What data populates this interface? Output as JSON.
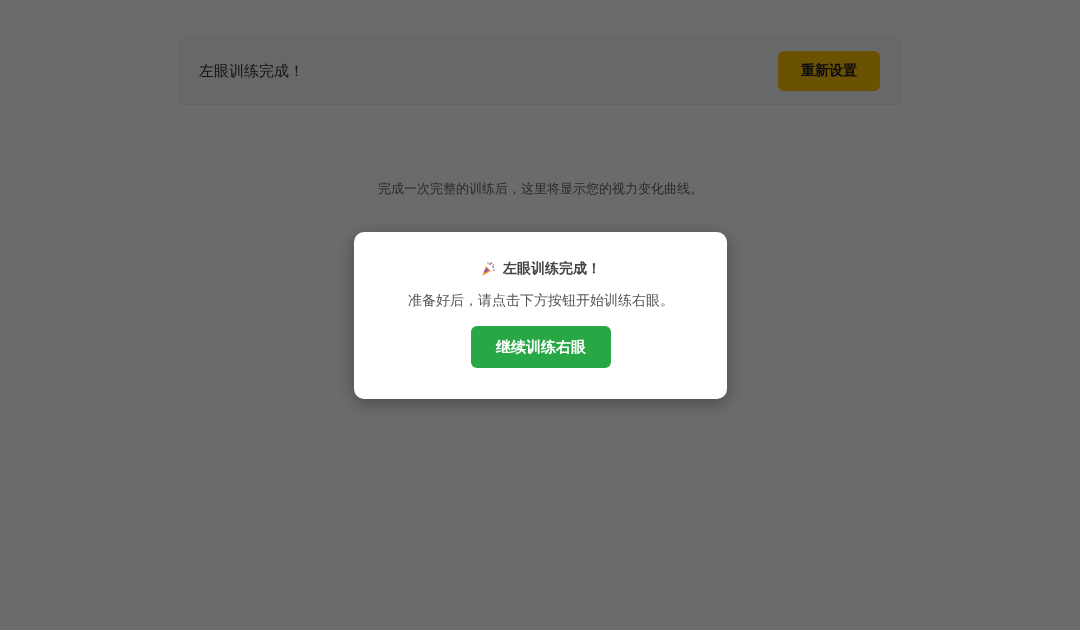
{
  "status_bar": {
    "message": "左眼训练完成！",
    "reset_button": "重新设置"
  },
  "chart_placeholder": "完成一次完整的训练后，这里将显示您的视力变化曲线。",
  "modal": {
    "title": "左眼训练完成！",
    "message": "准备好后，请点击下方按钮开始训练右眼。",
    "button": "继续训练右眼"
  }
}
